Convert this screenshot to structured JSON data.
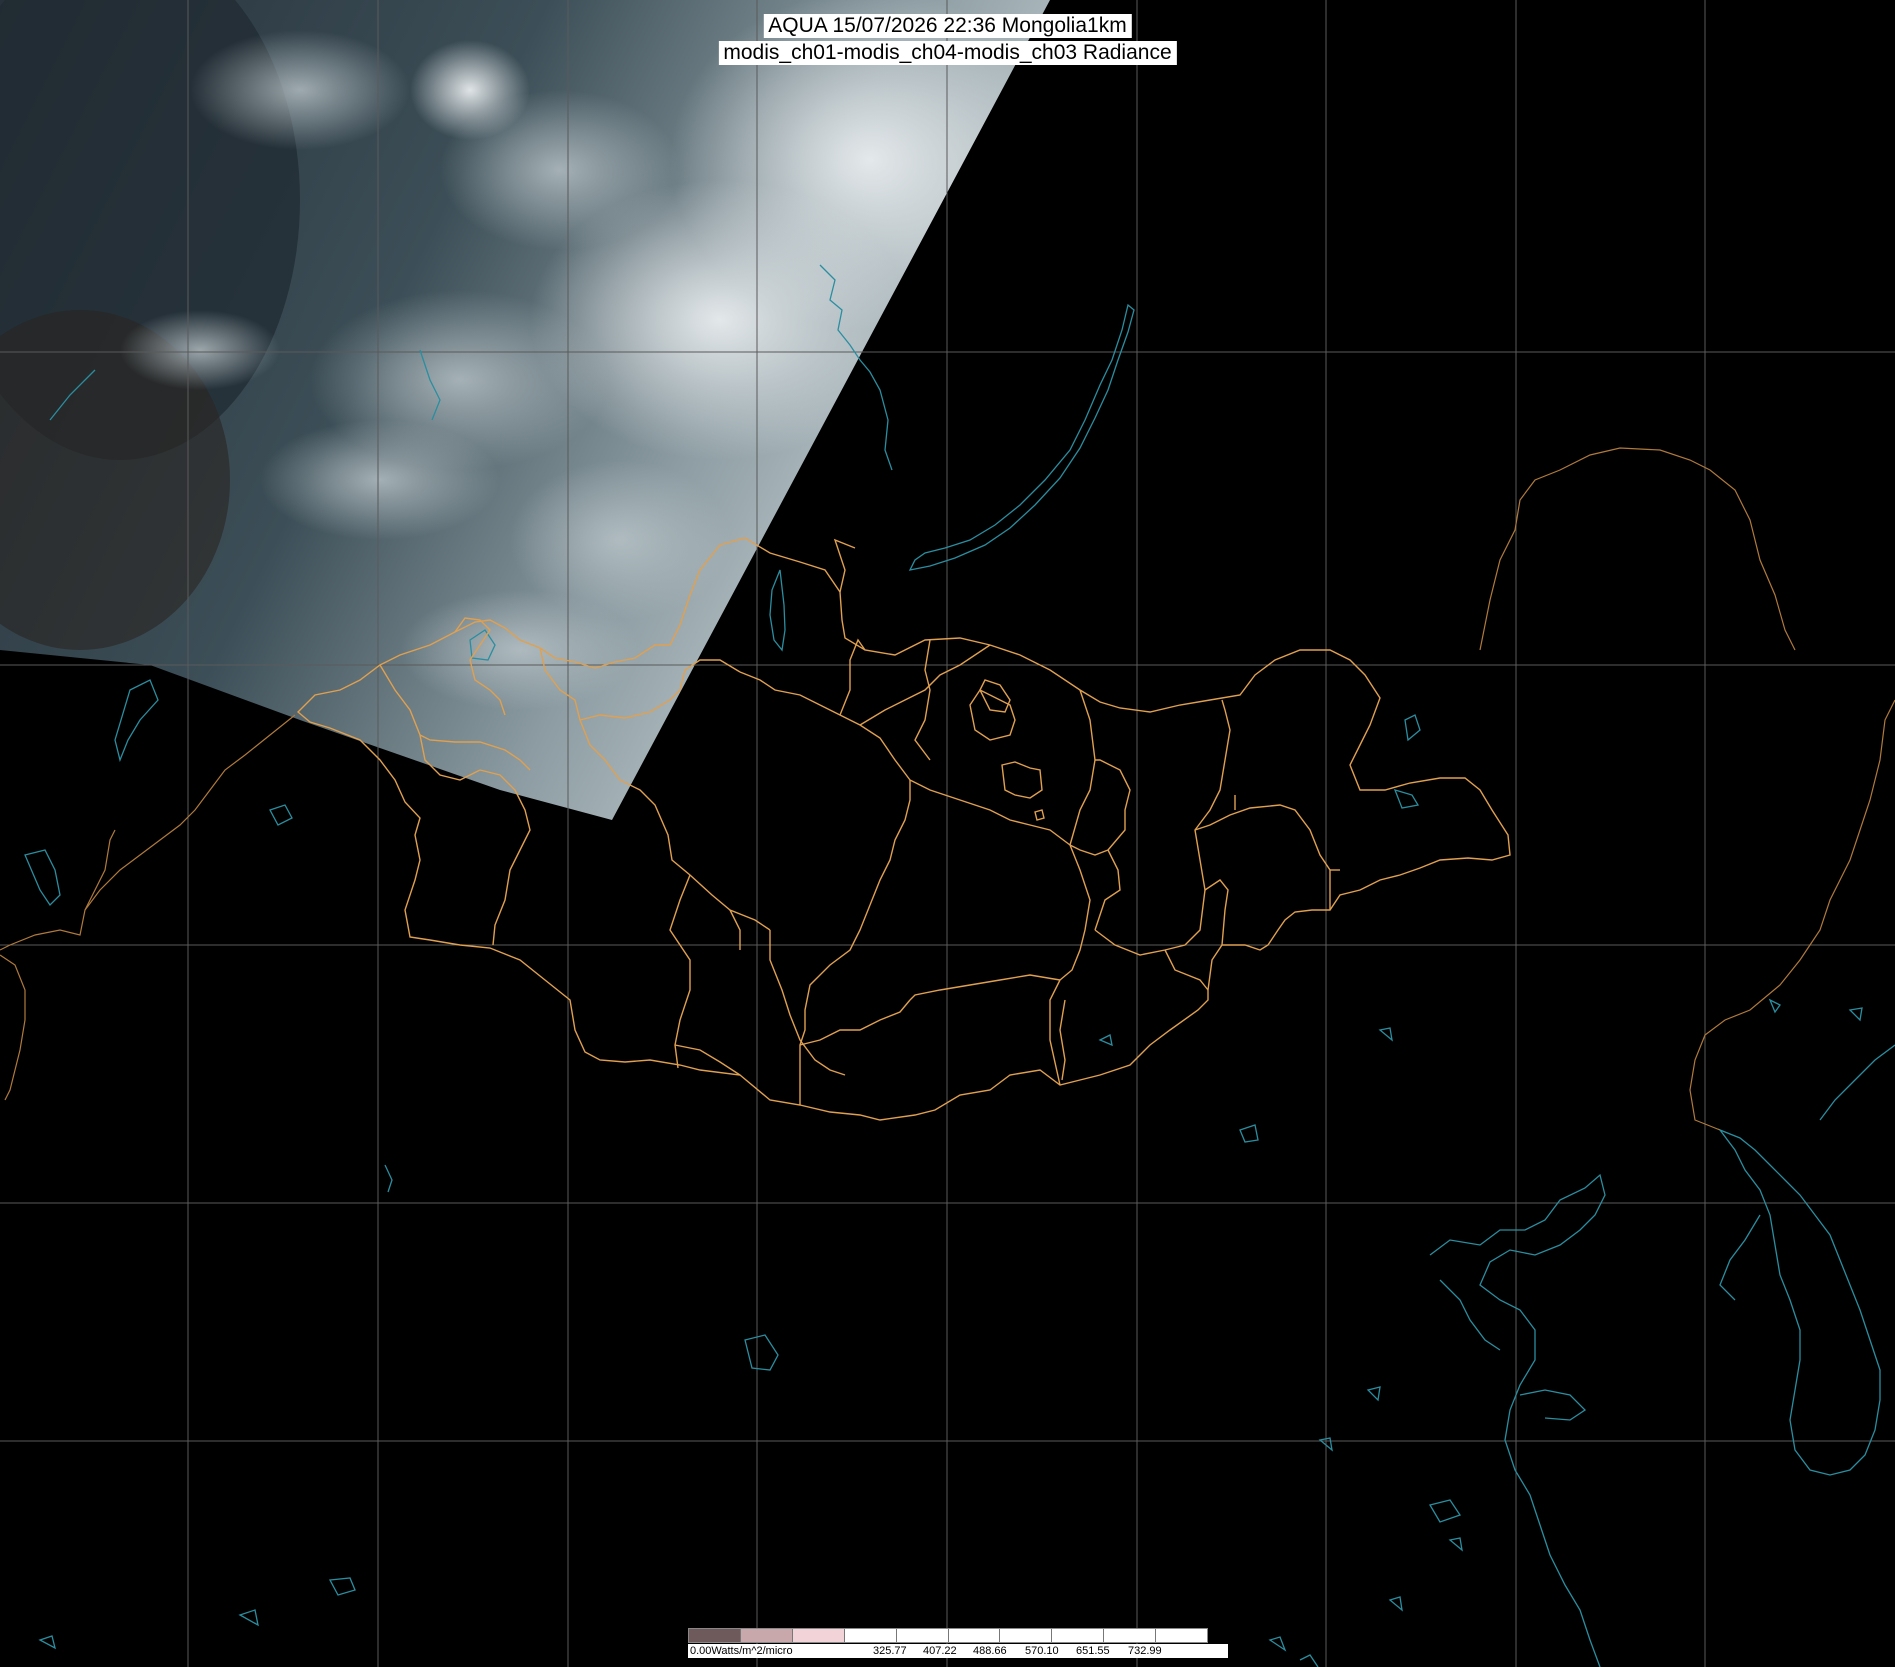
{
  "header": {
    "title_line1": "AQUA 15/07/2026 22:36 Mongolia1km",
    "title_line2": "modis_ch01-modis_ch04-modis_ch03 Radiance"
  },
  "map": {
    "colors": {
      "background": "#000000",
      "graticule": "#5a5a5a",
      "province_border": "#e0a050",
      "country_border": "#b07a3c",
      "coastline_lake": "#2a8ea0",
      "imagery_dark": "#2e3a40",
      "imagery_cloud": "#d8dde0"
    },
    "description_layers": [
      "satellite-swath",
      "graticule",
      "coastlines",
      "country-borders",
      "province-borders"
    ]
  },
  "legend": {
    "start_label": "0.00Watts/m^2/micro",
    "tick_labels": [
      "325.77",
      "407.22",
      "488.66",
      "570.10",
      "651.55",
      "732.99"
    ],
    "swatch_colors": [
      "#6e5a5a",
      "#c9a8ac",
      "#f1d3d8",
      "#ffffff",
      "#ffffff",
      "#ffffff",
      "#ffffff",
      "#ffffff",
      "#ffffff",
      "#ffffff"
    ]
  }
}
